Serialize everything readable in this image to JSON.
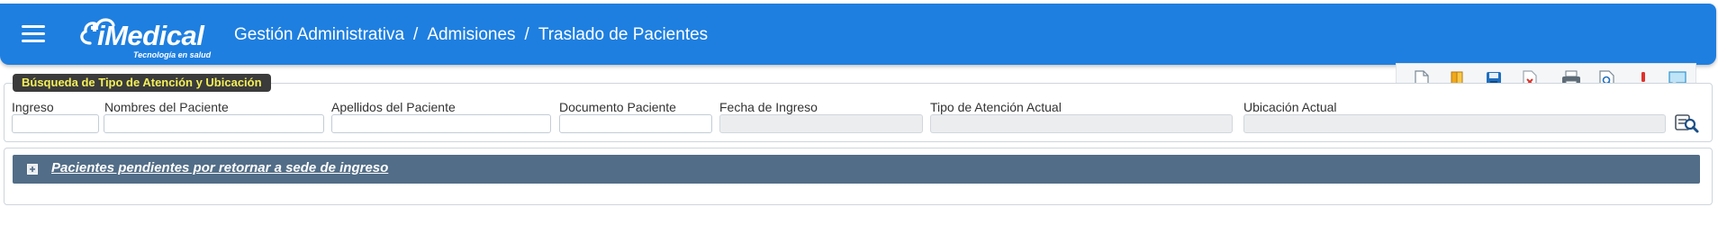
{
  "header": {
    "brand": "iMedical",
    "tagline": "Tecnología en salud",
    "breadcrumb": [
      "Gestión Administrativa",
      "Admisiones",
      "Traslado de Pacientes"
    ],
    "separator": "/"
  },
  "toolbar": {
    "icons": [
      "new-document-icon",
      "open-book-icon",
      "save-icon",
      "delete-icon",
      "print-icon",
      "preview-icon",
      "alert-icon",
      "comment-icon"
    ]
  },
  "search": {
    "legend": "Búsqueda de Tipo de Atención y Ubicación",
    "fields": {
      "ingreso": {
        "label": "Ingreso",
        "value": ""
      },
      "nombres": {
        "label": "Nombres del Paciente",
        "value": ""
      },
      "apellidos": {
        "label": "Apellidos del Paciente",
        "value": ""
      },
      "documento": {
        "label": "Documento Paciente",
        "value": ""
      },
      "fecha": {
        "label": "Fecha de Ingreso",
        "value": ""
      },
      "tipo_atencion": {
        "label": "Tipo de Atención Actual",
        "value": ""
      },
      "ubicacion": {
        "label": "Ubicación Actual",
        "value": ""
      }
    },
    "search_icon": "search-icon"
  },
  "pending": {
    "title": "Pacientes pendientes por retornar a sede de ingreso",
    "expanded": false
  },
  "colors": {
    "header_bg": "#1e7fe0",
    "legend_bg": "#3b3b3b",
    "legend_text": "#f3ef5a",
    "section_bar": "#526d87"
  }
}
